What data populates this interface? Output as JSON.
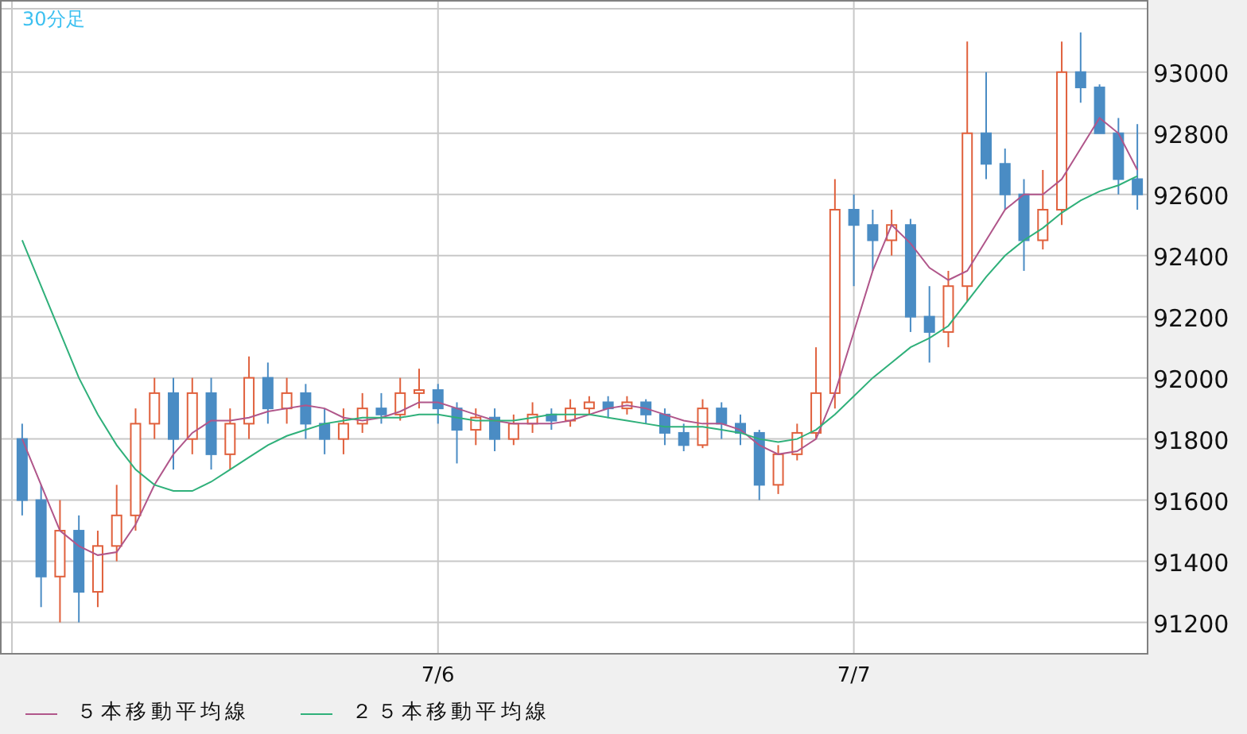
{
  "chart": {
    "label": "30分足",
    "chart_data": {
      "type": "candlestick",
      "grid": true,
      "categories": [
        null,
        null,
        null,
        null,
        null,
        null,
        null,
        null,
        null,
        null,
        null,
        null,
        null,
        null,
        null,
        null,
        null,
        null,
        null,
        null,
        null,
        null,
        "7/6",
        null,
        null,
        null,
        null,
        null,
        null,
        null,
        null,
        null,
        null,
        null,
        null,
        null,
        null,
        null,
        null,
        null,
        null,
        null,
        null,
        null,
        "7/7",
        null,
        null,
        null,
        null,
        null,
        null,
        null,
        null,
        null,
        null,
        null,
        null,
        null,
        null,
        null
      ],
      "ylim": [
        91100,
        93210
      ],
      "yticks": [
        91200,
        91400,
        91600,
        91800,
        92000,
        92200,
        92400,
        92600,
        92800,
        93000
      ],
      "ohlc": [
        [
          91800,
          91850,
          91550,
          91600
        ],
        [
          91600,
          91650,
          91250,
          91350
        ],
        [
          91350,
          91600,
          91200,
          91500
        ],
        [
          91500,
          91550,
          91200,
          91300
        ],
        [
          91300,
          91500,
          91250,
          91450
        ],
        [
          91450,
          91650,
          91400,
          91550
        ],
        [
          91550,
          91900,
          91500,
          91850
        ],
        [
          91850,
          92000,
          91800,
          91950
        ],
        [
          91950,
          92000,
          91700,
          91800
        ],
        [
          91800,
          92000,
          91750,
          91950
        ],
        [
          91950,
          92000,
          91700,
          91750
        ],
        [
          91750,
          91900,
          91700,
          91850
        ],
        [
          91850,
          92070,
          91800,
          92000
        ],
        [
          92000,
          92050,
          91850,
          91900
        ],
        [
          91900,
          92000,
          91850,
          91950
        ],
        [
          91950,
          91980,
          91800,
          91850
        ],
        [
          91850,
          91900,
          91750,
          91800
        ],
        [
          91800,
          91900,
          91750,
          91850
        ],
        [
          91850,
          91950,
          91820,
          91900
        ],
        [
          91900,
          91950,
          91850,
          91880
        ],
        [
          91880,
          92000,
          91860,
          91950
        ],
        [
          91950,
          92030,
          91900,
          91960
        ],
        [
          91960,
          91980,
          91850,
          91900
        ],
        [
          91900,
          91920,
          91720,
          91830
        ],
        [
          91830,
          91900,
          91780,
          91870
        ],
        [
          91870,
          91900,
          91760,
          91800
        ],
        [
          91800,
          91880,
          91780,
          91850
        ],
        [
          91850,
          91920,
          91820,
          91880
        ],
        [
          91880,
          91900,
          91830,
          91860
        ],
        [
          91860,
          91930,
          91840,
          91900
        ],
        [
          91900,
          91940,
          91880,
          91920
        ],
        [
          91920,
          91940,
          91870,
          91900
        ],
        [
          91900,
          91940,
          91880,
          91920
        ],
        [
          91920,
          91930,
          91850,
          91880
        ],
        [
          91880,
          91900,
          91780,
          91820
        ],
        [
          91820,
          91850,
          91760,
          91780
        ],
        [
          91780,
          91930,
          91770,
          91900
        ],
        [
          91900,
          91920,
          91800,
          91850
        ],
        [
          91850,
          91880,
          91780,
          91820
        ],
        [
          91820,
          91830,
          91600,
          91650
        ],
        [
          91650,
          91780,
          91620,
          91750
        ],
        [
          91750,
          91850,
          91730,
          91820
        ],
        [
          91820,
          92100,
          91800,
          91950
        ],
        [
          91950,
          92650,
          91900,
          92550
        ],
        [
          92550,
          92600,
          92300,
          92500
        ],
        [
          92500,
          92550,
          92350,
          92450
        ],
        [
          92450,
          92550,
          92400,
          92500
        ],
        [
          92500,
          92520,
          92150,
          92200
        ],
        [
          92200,
          92300,
          92050,
          92150
        ],
        [
          92150,
          92350,
          92100,
          92300
        ],
        [
          92300,
          93100,
          92250,
          92800
        ],
        [
          92800,
          93000,
          92650,
          92700
        ],
        [
          92700,
          92750,
          92550,
          92600
        ],
        [
          92600,
          92650,
          92350,
          92450
        ],
        [
          92450,
          92680,
          92420,
          92550
        ],
        [
          92550,
          93100,
          92500,
          93000
        ],
        [
          93000,
          93130,
          92900,
          92950
        ],
        [
          92950,
          92960,
          92800,
          92800
        ],
        [
          92800,
          92850,
          92600,
          92650
        ],
        [
          92650,
          92830,
          92550,
          92600
        ]
      ],
      "series": [
        {
          "name": "５本移動平均線",
          "type": "line",
          "color": "#b0568a",
          "values": [
            91800,
            91650,
            91500,
            91450,
            91420,
            91430,
            91520,
            91650,
            91750,
            91820,
            91860,
            91860,
            91870,
            91890,
            91900,
            91910,
            91900,
            91870,
            91860,
            91870,
            91890,
            91920,
            91920,
            91900,
            91880,
            91860,
            91850,
            91850,
            91850,
            91860,
            91880,
            91900,
            91910,
            91900,
            91880,
            91860,
            91850,
            91850,
            91830,
            91780,
            91750,
            91760,
            91800,
            91950,
            92150,
            92350,
            92500,
            92440,
            92360,
            92320,
            92350,
            92450,
            92550,
            92600,
            92600,
            92650,
            92750,
            92850,
            92800,
            92680
          ]
        },
        {
          "name": "２５本移動平均線",
          "type": "line",
          "color": "#2fb07a",
          "values": [
            92450,
            92300,
            92150,
            92000,
            91880,
            91780,
            91700,
            91650,
            91630,
            91630,
            91660,
            91700,
            91740,
            91780,
            91810,
            91830,
            91850,
            91860,
            91870,
            91870,
            91870,
            91880,
            91880,
            91870,
            91860,
            91860,
            91860,
            91870,
            91880,
            91880,
            91880,
            91870,
            91860,
            91850,
            91840,
            91840,
            91840,
            91830,
            91820,
            91800,
            91790,
            91800,
            91830,
            91880,
            91940,
            92000,
            92050,
            92100,
            92130,
            92170,
            92250,
            92330,
            92400,
            92450,
            92490,
            92540,
            92580,
            92610,
            92630,
            92660
          ]
        }
      ]
    }
  }
}
